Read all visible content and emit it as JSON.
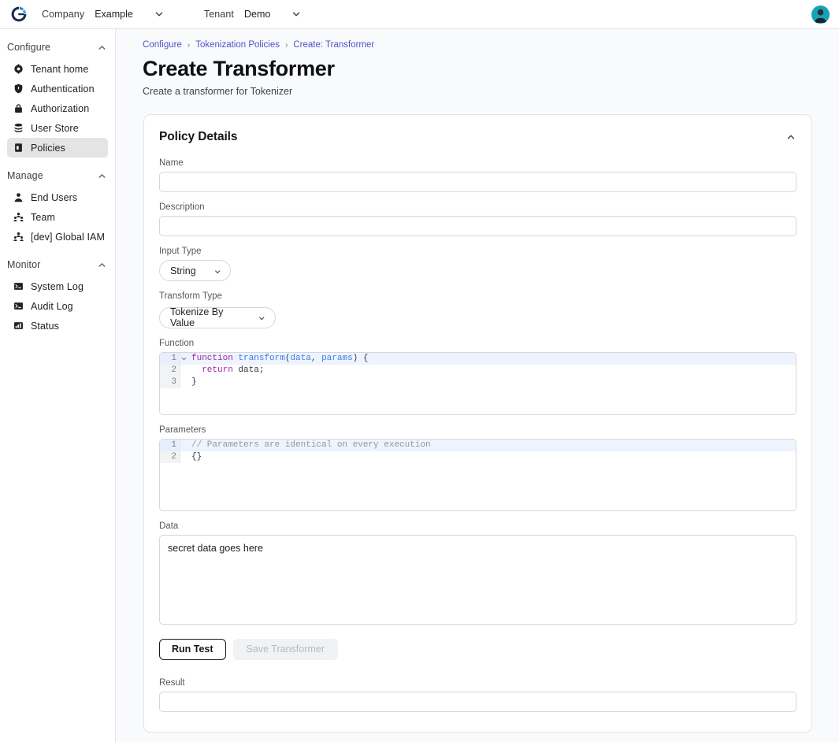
{
  "topbar": {
    "logo_icon": "userclouds-logo-icon",
    "company_label": "Company",
    "company_value": "Example",
    "company_chevron_icon": "chevron-down-icon",
    "tenant_label": "Tenant",
    "tenant_value": "Demo",
    "tenant_chevron_icon": "chevron-down-icon",
    "avatar_icon": "user-avatar"
  },
  "sidebar": {
    "sections": [
      {
        "title": "Configure",
        "chevron_icon": "chevron-up-icon",
        "items": [
          {
            "label": "Tenant home",
            "icon": "gear-icon",
            "active": false
          },
          {
            "label": "Authentication",
            "icon": "shield-icon",
            "active": false
          },
          {
            "label": "Authorization",
            "icon": "lock-icon",
            "active": false
          },
          {
            "label": "User Store",
            "icon": "database-icon",
            "active": false
          },
          {
            "label": "Policies",
            "icon": "policy-icon",
            "active": true
          }
        ]
      },
      {
        "title": "Manage",
        "chevron_icon": "chevron-up-icon",
        "items": [
          {
            "label": "End Users",
            "icon": "user-icon",
            "active": false
          },
          {
            "label": "Team",
            "icon": "users-icon",
            "active": false
          },
          {
            "label": "[dev] Global IAM",
            "icon": "users-icon",
            "active": false
          }
        ]
      },
      {
        "title": "Monitor",
        "chevron_icon": "chevron-up-icon",
        "items": [
          {
            "label": "System Log",
            "icon": "terminal-icon",
            "active": false
          },
          {
            "label": "Audit Log",
            "icon": "terminal-icon",
            "active": false
          },
          {
            "label": "Status",
            "icon": "chart-icon",
            "active": false
          }
        ]
      }
    ]
  },
  "breadcrumb": {
    "items": [
      "Configure",
      "Tokenization Policies",
      "Create: Transformer"
    ],
    "separator": "›"
  },
  "page": {
    "title": "Create Transformer",
    "subtitle": "Create a transformer for Tokenizer"
  },
  "card": {
    "title": "Policy Details",
    "collapse_icon": "chevron-up-icon",
    "name": {
      "label": "Name",
      "value": "",
      "placeholder": ""
    },
    "description": {
      "label": "Description",
      "value": "",
      "placeholder": ""
    },
    "input_type": {
      "label": "Input Type",
      "value": "String",
      "chevron_icon": "chevron-down-icon",
      "options": [
        "String"
      ]
    },
    "transform_type": {
      "label": "Transform Type",
      "value": "Tokenize By Value",
      "chevron_icon": "chevron-down-icon",
      "options": [
        "Tokenize By Value"
      ]
    },
    "function": {
      "label": "Function",
      "fold_icon": "chevron-down-icon",
      "lines": [
        {
          "num": "1",
          "highlight": true,
          "fold": true,
          "tokens": [
            {
              "t": "function",
              "c": "tok-kw"
            },
            {
              "t": " ",
              "c": "tok-pl"
            },
            {
              "t": "transform",
              "c": "tok-fn"
            },
            {
              "t": "(",
              "c": "tok-pl"
            },
            {
              "t": "data",
              "c": "tok-var"
            },
            {
              "t": ", ",
              "c": "tok-pl"
            },
            {
              "t": "params",
              "c": "tok-var"
            },
            {
              "t": ") {",
              "c": "tok-pl"
            }
          ]
        },
        {
          "num": "2",
          "highlight": false,
          "fold": false,
          "tokens": [
            {
              "t": "  ",
              "c": "tok-pl"
            },
            {
              "t": "return",
              "c": "tok-kw"
            },
            {
              "t": " data;",
              "c": "tok-pl"
            }
          ]
        },
        {
          "num": "3",
          "highlight": false,
          "fold": false,
          "tokens": [
            {
              "t": "}",
              "c": "tok-pl"
            }
          ]
        }
      ]
    },
    "parameters": {
      "label": "Parameters",
      "lines": [
        {
          "num": "1",
          "highlight": true,
          "fold": false,
          "tokens": [
            {
              "t": "// Parameters are identical on every execution",
              "c": "tok-cm"
            }
          ]
        },
        {
          "num": "2",
          "highlight": false,
          "fold": false,
          "tokens": [
            {
              "t": "{}",
              "c": "tok-pl"
            }
          ]
        }
      ]
    },
    "data": {
      "label": "Data",
      "value": "secret data goes here",
      "placeholder": ""
    },
    "run_test_label": "Run Test",
    "save_label": "Save Transformer",
    "result": {
      "label": "Result",
      "value": "",
      "placeholder": ""
    }
  },
  "colors": {
    "accent_link": "#4f52c9",
    "active_nav": "#e4e4e5",
    "editor_highlight": "#edf4fd",
    "keyword": "#a626a4",
    "function": "#4078f2",
    "comment": "#9298a0",
    "page_bg": "#f9fafc"
  }
}
